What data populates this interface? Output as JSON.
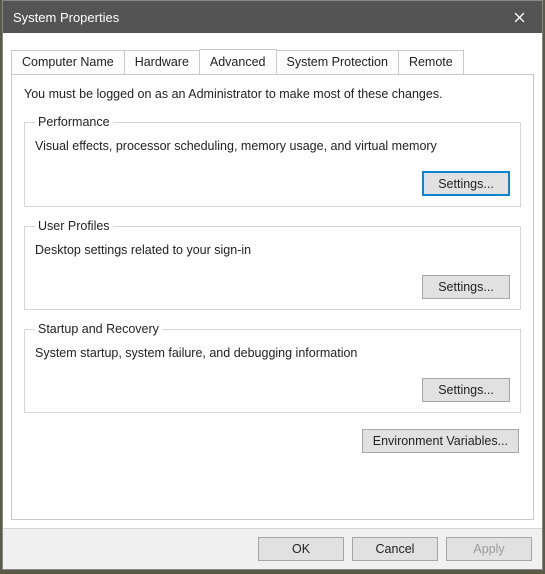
{
  "title": "System Properties",
  "tabs": [
    {
      "label": "Computer Name"
    },
    {
      "label": "Hardware"
    },
    {
      "label": "Advanced"
    },
    {
      "label": "System Protection"
    },
    {
      "label": "Remote"
    }
  ],
  "activeTab": 2,
  "intro": "You must be logged on as an Administrator to make most of these changes.",
  "groups": {
    "performance": {
      "legend": "Performance",
      "desc": "Visual effects, processor scheduling, memory usage, and virtual memory",
      "button": "Settings..."
    },
    "userProfiles": {
      "legend": "User Profiles",
      "desc": "Desktop settings related to your sign-in",
      "button": "Settings..."
    },
    "startupRecovery": {
      "legend": "Startup and Recovery",
      "desc": "System startup, system failure, and debugging information",
      "button": "Settings..."
    }
  },
  "envButton": "Environment Variables...",
  "footer": {
    "ok": "OK",
    "cancel": "Cancel",
    "apply": "Apply"
  }
}
